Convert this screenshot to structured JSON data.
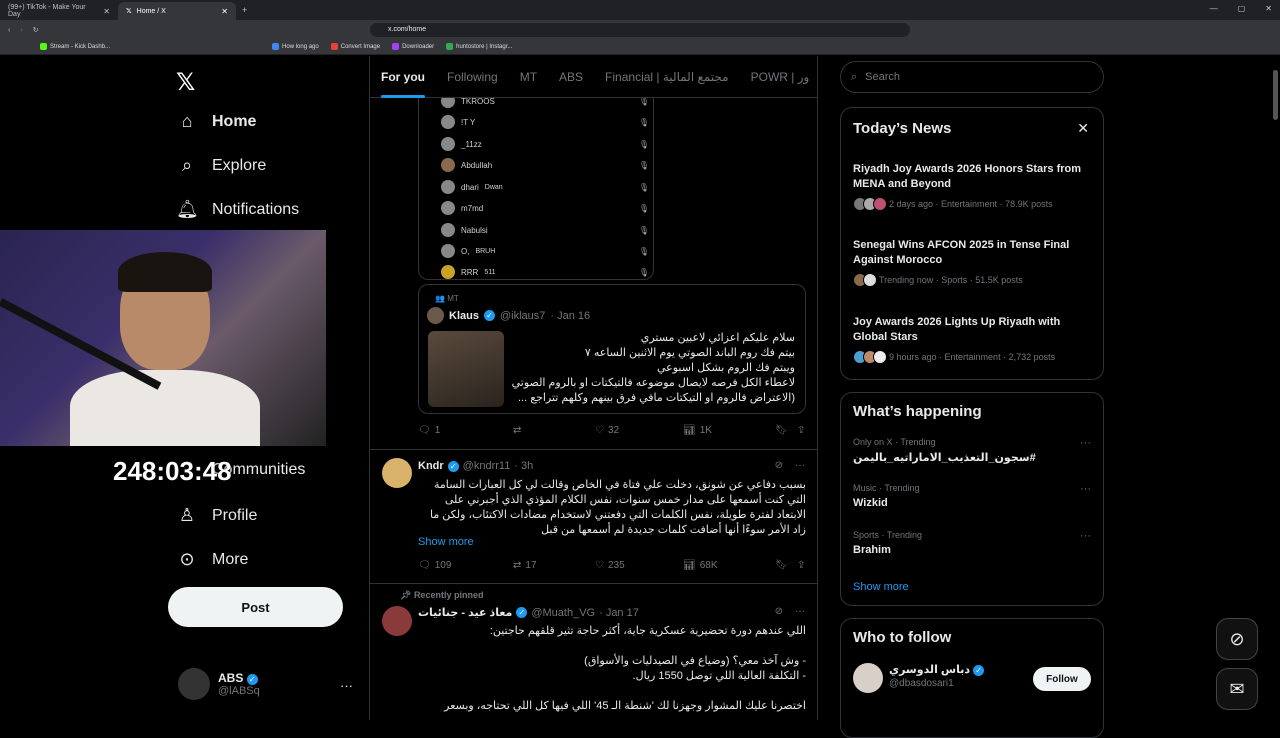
{
  "browser": {
    "tabs": [
      {
        "title": "(99+) TikTok - Make Your Day"
      },
      {
        "title": "Home / X"
      }
    ],
    "url": "x.com/home",
    "bookmarks": [
      "Stream - Kick Dashb...",
      "How long ago",
      "Convert Image",
      "Downloader",
      "huntostore | Instagr..."
    ]
  },
  "sidebar": {
    "nav": {
      "home": "Home",
      "explore": "Explore",
      "notifications": "Notifications",
      "communities": "Communities",
      "profile": "Profile",
      "more": "More"
    },
    "post_label": "Post",
    "account": {
      "name": "ABS",
      "handle": "@lABSq"
    }
  },
  "overlay_timer": "248:03:48",
  "feed": {
    "tabs": [
      "For you",
      "Following",
      "MT",
      "ABS",
      "Financial | مجتمع المالية",
      "POWR | ور"
    ],
    "voice_list": [
      {
        "name": "TKROOS"
      },
      {
        "name": "!T Y"
      },
      {
        "name": "_11zz"
      },
      {
        "name": "Abdullah"
      },
      {
        "name": "dhari",
        "tag": "Dwan"
      },
      {
        "name": "m7md"
      },
      {
        "name": "Nabulsi"
      },
      {
        "name": "O,",
        "tag": "BRUH"
      },
      {
        "name": "RRR",
        "tag": "511"
      }
    ],
    "quote": {
      "context": "MT",
      "name": "Klaus",
      "handle": "@iklaus7",
      "date": "· Jan 16",
      "lines": [
        "سلام عليكم اعزائي لاعبين مستري",
        "بيتم فك روم الباند الصوتي يوم الاثنين الساعه ٧",
        "ويبتم فك الروم بشكل اسبوعي",
        "لاعطاء الكل فرصه لايصال موضوعه فالتيكتات او بالروم الصوتي",
        "(الاعتراض فالروم او التيكتات مافي فرق بينهم وكلهم تتراجع ..."
      ]
    },
    "post1_actions": {
      "replies": "1",
      "reposts": "",
      "likes": "32",
      "views": "1K"
    },
    "post2": {
      "name": "Kndr",
      "handle": "@kndrr11",
      "time": "· 3h",
      "text": "بسبب دفاعي عن شونق، دخلت علي فتاة في الخاص وقالت لي كل العبارات السامة التي كنت أسمعها على مدار خمس سنوات، نفس الكلام المؤذي الذي أجبرني على الابتعاد لفترة طويلة، نفس الكلمات التي دفعتني لاستخدام مضادات الاكتئاب، ولكن ما زاد الأمر سوءًا أنها أضافت كلمات جديدة لم أسمعها من قبل",
      "show_more": "Show more",
      "actions": {
        "replies": "109",
        "reposts": "17",
        "likes": "235",
        "views": "68K"
      }
    },
    "post3": {
      "pinned": "Recently pinned",
      "name": "معاذ عيد - جنائيات",
      "handle": "@Muath_VG",
      "date": "· Jan 17",
      "lines": [
        "اللي عندهم دورة تحضيرية عسكرية جاية، أكثر حاجة تثير قلقهم حاجتين:",
        "",
        "- وش آخذ معي؟ (وضياع في الصيدليات والأسواق)",
        "- التكلفة العالية اللي توصل 1550 ريال.",
        "",
        "اختصرنا عليك المشوار وجهزنا لك 'شنطة الـ 45' اللي فيها كل اللي تحتاجه، وبسعر"
      ]
    }
  },
  "right": {
    "search_placeholder": "Search",
    "news_title": "Today’s News",
    "news": [
      {
        "title": "Riyadh Joy Awards 2026 Honors Stars from MENA and Beyond",
        "meta": "2 days ago · Entertainment · 78.9K posts"
      },
      {
        "title": "Senegal Wins AFCON 2025 in Tense Final Against Morocco",
        "meta": "Trending now · Sports · 51.5K posts"
      },
      {
        "title": "Joy Awards 2026 Lights Up Riyadh with Global Stars",
        "meta": "9 hours ago · Entertainment · 2,732 posts"
      }
    ],
    "happening_title": "What’s happening",
    "trends": [
      {
        "context": "Only on X · Trending",
        "name": "#سجون_التعذيب_الاماراتيه_باليمن"
      },
      {
        "context": "Music · Trending",
        "name": "Wizkid"
      },
      {
        "context": "Sports · Trending",
        "name": "Brahim"
      }
    ],
    "show_more": "Show more",
    "follow_title": "Who to follow",
    "follow": {
      "name": "دباس الدوسري",
      "handle": "@dbasdosari1",
      "button": "Follow"
    }
  },
  "colors": {
    "accent": "#1d9bf0",
    "bg": "#000000",
    "border": "#2f3336"
  }
}
